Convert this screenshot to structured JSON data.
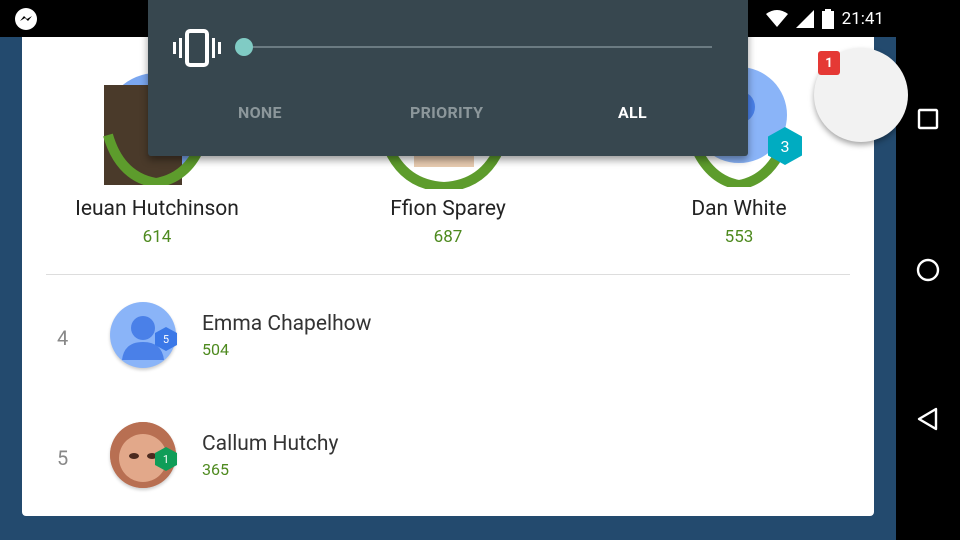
{
  "status_bar": {
    "time": "21:41",
    "icons": [
      "messenger-icon",
      "vibrate-icon",
      "wifi-icon",
      "signal-icon",
      "battery-icon"
    ]
  },
  "notification_panel": {
    "icon": "vibrate-icon",
    "volume_level": 0,
    "modes": [
      {
        "label": "NONE",
        "selected": false
      },
      {
        "label": "PRIORITY",
        "selected": false
      },
      {
        "label": "ALL",
        "selected": true
      }
    ]
  },
  "leaderboard": {
    "podium": [
      {
        "name": "Ieuan Hutchinson",
        "score": "614"
      },
      {
        "name": "Ffion Sparey",
        "score": "687"
      },
      {
        "name": "Dan White",
        "score": "553",
        "level": "3"
      }
    ],
    "rows": [
      {
        "rank": "4",
        "name": "Emma Chapelhow",
        "score": "504",
        "level": "5"
      },
      {
        "rank": "5",
        "name": "Callum Hutchy",
        "score": "365",
        "level": "1"
      }
    ]
  },
  "fab": {
    "badge_count": "1"
  },
  "nav": {
    "buttons": [
      "back-icon",
      "home-icon",
      "recents-icon"
    ]
  },
  "colors": {
    "score_green": "#4e8a1f",
    "overlay_bg": "#37474f",
    "slider_accent": "#80cbc4",
    "badge_red": "#e53935",
    "level_teal": "#00acc1",
    "level_blue": "#3b78e7",
    "level_green": "#0f9d58"
  }
}
